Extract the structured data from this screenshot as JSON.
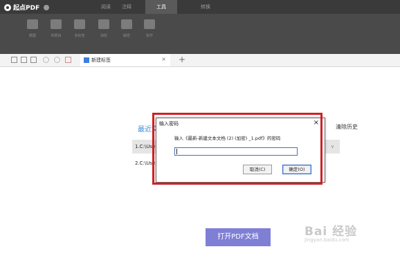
{
  "app": {
    "name": "起点PDF"
  },
  "menu": {
    "tabs": [
      {
        "label": "阅读",
        "active": false
      },
      {
        "label": "注释",
        "active": false
      },
      {
        "label": "工具",
        "active": true
      },
      {
        "label": "转换",
        "active": false
      }
    ]
  },
  "toolbar": {
    "tools": [
      {
        "label": "截图",
        "icon": "scissors-icon"
      },
      {
        "label": "快照目",
        "icon": "list-icon"
      },
      {
        "label": "多标签",
        "icon": "pages-icon"
      },
      {
        "label": "加密",
        "icon": "lock-icon"
      },
      {
        "label": "解密",
        "icon": "unlock-icon"
      },
      {
        "label": "拆开",
        "icon": "split-icon"
      }
    ]
  },
  "document_tabs": {
    "active_tab": {
      "title": "新建标签",
      "close_symbol": "×"
    },
    "add_symbol": "+"
  },
  "start_page": {
    "recent_title": "最近文",
    "history_link": "清除历史",
    "recent_files": [
      {
        "path": "1.C:\\Use",
        "arrow": "∨"
      },
      {
        "path": "2.C:\\Use",
        "arrow": ""
      }
    ],
    "open_button": "打开PDF文档"
  },
  "dialog": {
    "title": "输入密码",
    "close_symbol": "×",
    "prompt": "输入《最新-新建文本文档 (2) (加密) _1.pdf》的密码",
    "input_value": "",
    "cancel_label": "取消(C)",
    "ok_label": "确定(O)"
  },
  "watermark": {
    "main": "Bai 经验",
    "sub": "jingyan.baidu.com"
  },
  "colors": {
    "accent_blue": "#3d8fd8",
    "open_button": "#7f7fd6",
    "highlight_red": "#cf2025",
    "topbar": "#3a3a3a",
    "toolbar": "#4a4a4a"
  }
}
